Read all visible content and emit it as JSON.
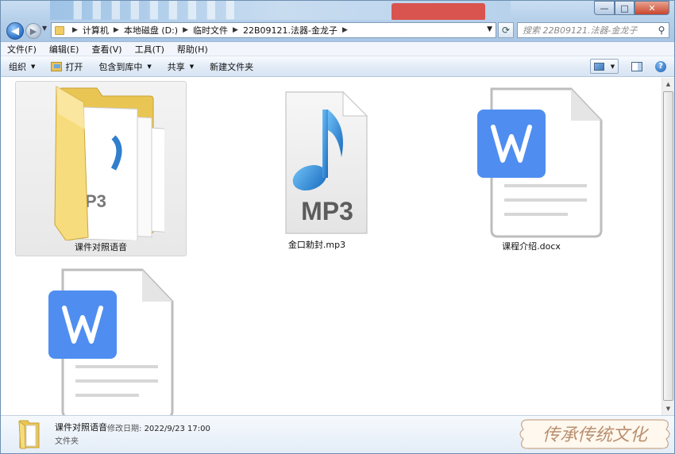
{
  "window": {
    "address": {
      "breadcrumbs": [
        "计算机",
        "本地磁盘 (D:)",
        "临时文件",
        "22B09121.法器-金龙子"
      ]
    },
    "search_placeholder": "搜索 22B09121.法器-金龙子",
    "controls": {
      "minimize": "—",
      "maximize": "□",
      "close": "✕"
    }
  },
  "menu": [
    "文件(F)",
    "编辑(E)",
    "查看(V)",
    "工具(T)",
    "帮助(H)"
  ],
  "commands": {
    "organize": "组织",
    "open": "打开",
    "include_library": "包含到库中",
    "share": "共享",
    "new_folder": "新建文件夹"
  },
  "files": [
    {
      "name": "课件对照语音",
      "type": "folder",
      "selected": true
    },
    {
      "name": "金口勅封.mp3",
      "type": "mp3",
      "badge": "MP3"
    },
    {
      "name": "课程介绍.docx",
      "type": "docx"
    },
    {
      "name": "",
      "type": "docx"
    }
  ],
  "details": {
    "name": "课件对照语音",
    "modified_label": "修改日期:",
    "modified_value": "2022/9/23 17:00",
    "type": "文件夹"
  },
  "watermark_text": "传承传统文化",
  "colors": {
    "wps_blue": "#4f8ef0",
    "folder_yellow": "#f3d36d",
    "mp3_note": "#2b7fd0"
  }
}
